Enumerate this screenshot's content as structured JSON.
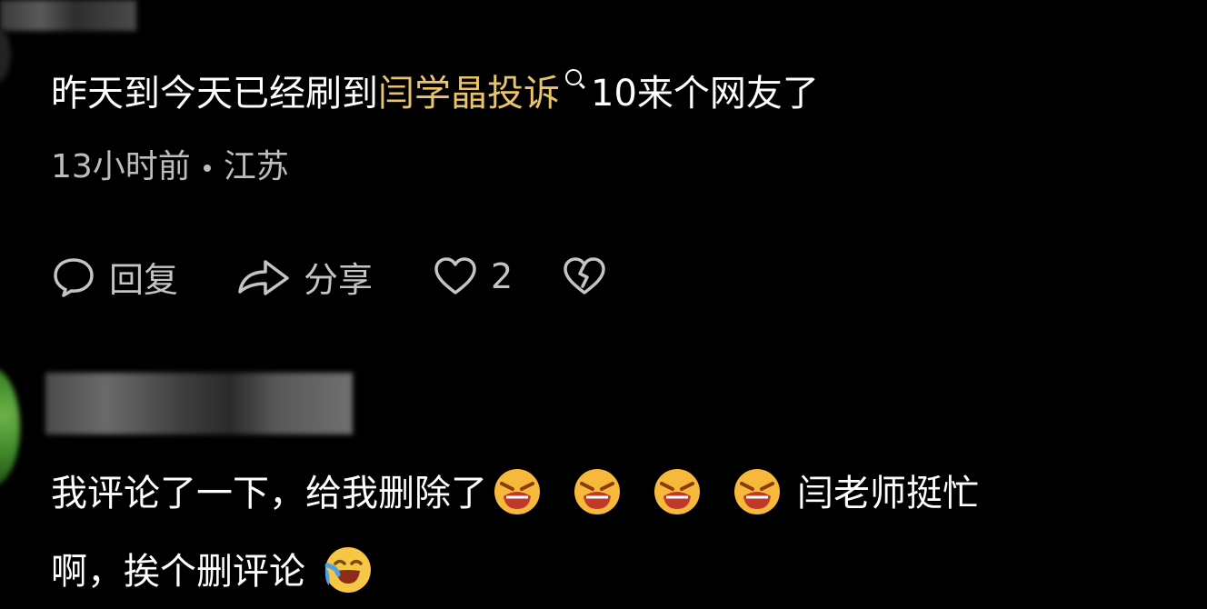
{
  "comment1": {
    "text_before": "昨天到今天已经刷到",
    "keyword": "闫学晶投诉",
    "text_after": "10来个网友了",
    "time": "13小时前",
    "location": "江苏",
    "actions": {
      "reply_label": "回复",
      "share_label": "分享",
      "like_count": "2",
      "icons": [
        "comment-icon",
        "share-icon",
        "heart-icon",
        "broken-heart-icon"
      ]
    }
  },
  "comment2": {
    "line1_text": "我评论了一下，给我删除了",
    "line1_tail": "闫老师挺忙",
    "line2_text": "啊，挨个删评论",
    "emojis": [
      "angry-face-emoji",
      "angry-face-emoji",
      "angry-face-emoji",
      "angry-face-emoji",
      "crying-laughing-emoji"
    ]
  },
  "colors": {
    "background": "#000000",
    "text": "#ffffff",
    "keyword": "#e9c46a",
    "meta": "#bdbdbd",
    "action": "#c4c4c4"
  }
}
